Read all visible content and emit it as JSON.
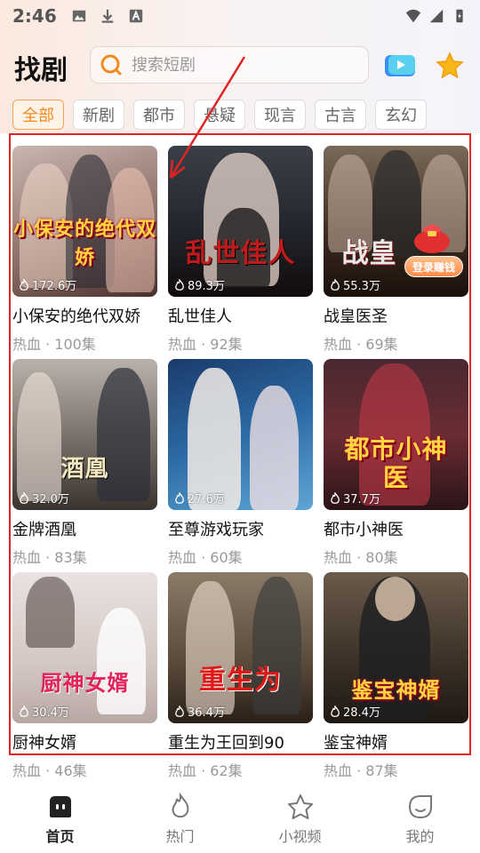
{
  "status_bar": {
    "time": "2:46"
  },
  "header": {
    "title": "找剧",
    "search_placeholder": "搜索短剧"
  },
  "tabs": [
    {
      "label": "全部",
      "active": true
    },
    {
      "label": "新剧",
      "active": false
    },
    {
      "label": "都市",
      "active": false
    },
    {
      "label": "悬疑",
      "active": false
    },
    {
      "label": "现言",
      "active": false
    },
    {
      "label": "古言",
      "active": false
    },
    {
      "label": "玄幻",
      "active": false
    }
  ],
  "dramas": [
    {
      "title": "小保安的绝代双娇",
      "views": "172.6万",
      "genre": "热血",
      "episodes": "100集",
      "meta": "热血 · 100集",
      "poster_text": "小保安的绝代双娇"
    },
    {
      "title": "乱世佳人",
      "views": "89.3万",
      "genre": "热血",
      "episodes": "92集",
      "meta": "热血 · 92集",
      "poster_text": "乱世佳人"
    },
    {
      "title": "战皇医圣",
      "views": "55.3万",
      "genre": "热血",
      "episodes": "69集",
      "meta": "热血 · 69集",
      "poster_text": "战皇",
      "badge": "登录赚钱"
    },
    {
      "title": "金牌酒凰",
      "views": "32.0万",
      "genre": "热血",
      "episodes": "83集",
      "meta": "热血 · 83集",
      "poster_text": "酒凰"
    },
    {
      "title": "至尊游戏玩家",
      "views": "27.6万",
      "genre": "热血",
      "episodes": "60集",
      "meta": "热血 · 60集",
      "poster_text": ""
    },
    {
      "title": "都市小神医",
      "views": "37.7万",
      "genre": "热血",
      "episodes": "80集",
      "meta": "热血 · 80集",
      "poster_text": "都市小神医"
    },
    {
      "title": "厨神女婿",
      "views": "30.4万",
      "genre": "热血",
      "episodes": "46集",
      "meta": "热血 · 46集",
      "poster_text": "厨神女婿"
    },
    {
      "title": "重生为王回到90",
      "views": "36.4万",
      "genre": "热血",
      "episodes": "62集",
      "meta": "热血 · 62集",
      "poster_text": "重生为"
    },
    {
      "title": "鉴宝神婿",
      "views": "28.4万",
      "genre": "热血",
      "episodes": "87集",
      "meta": "热血 · 87集",
      "poster_text": "鉴宝神婿"
    }
  ],
  "bottom_nav": [
    {
      "label": "首页",
      "icon": "home-icon",
      "active": true
    },
    {
      "label": "热门",
      "icon": "flame-icon",
      "active": false
    },
    {
      "label": "小视频",
      "icon": "star-icon",
      "active": false
    },
    {
      "label": "我的",
      "icon": "profile-icon",
      "active": false
    }
  ],
  "colors": {
    "accent": "#f28a1e",
    "annotation": "#e02424"
  }
}
